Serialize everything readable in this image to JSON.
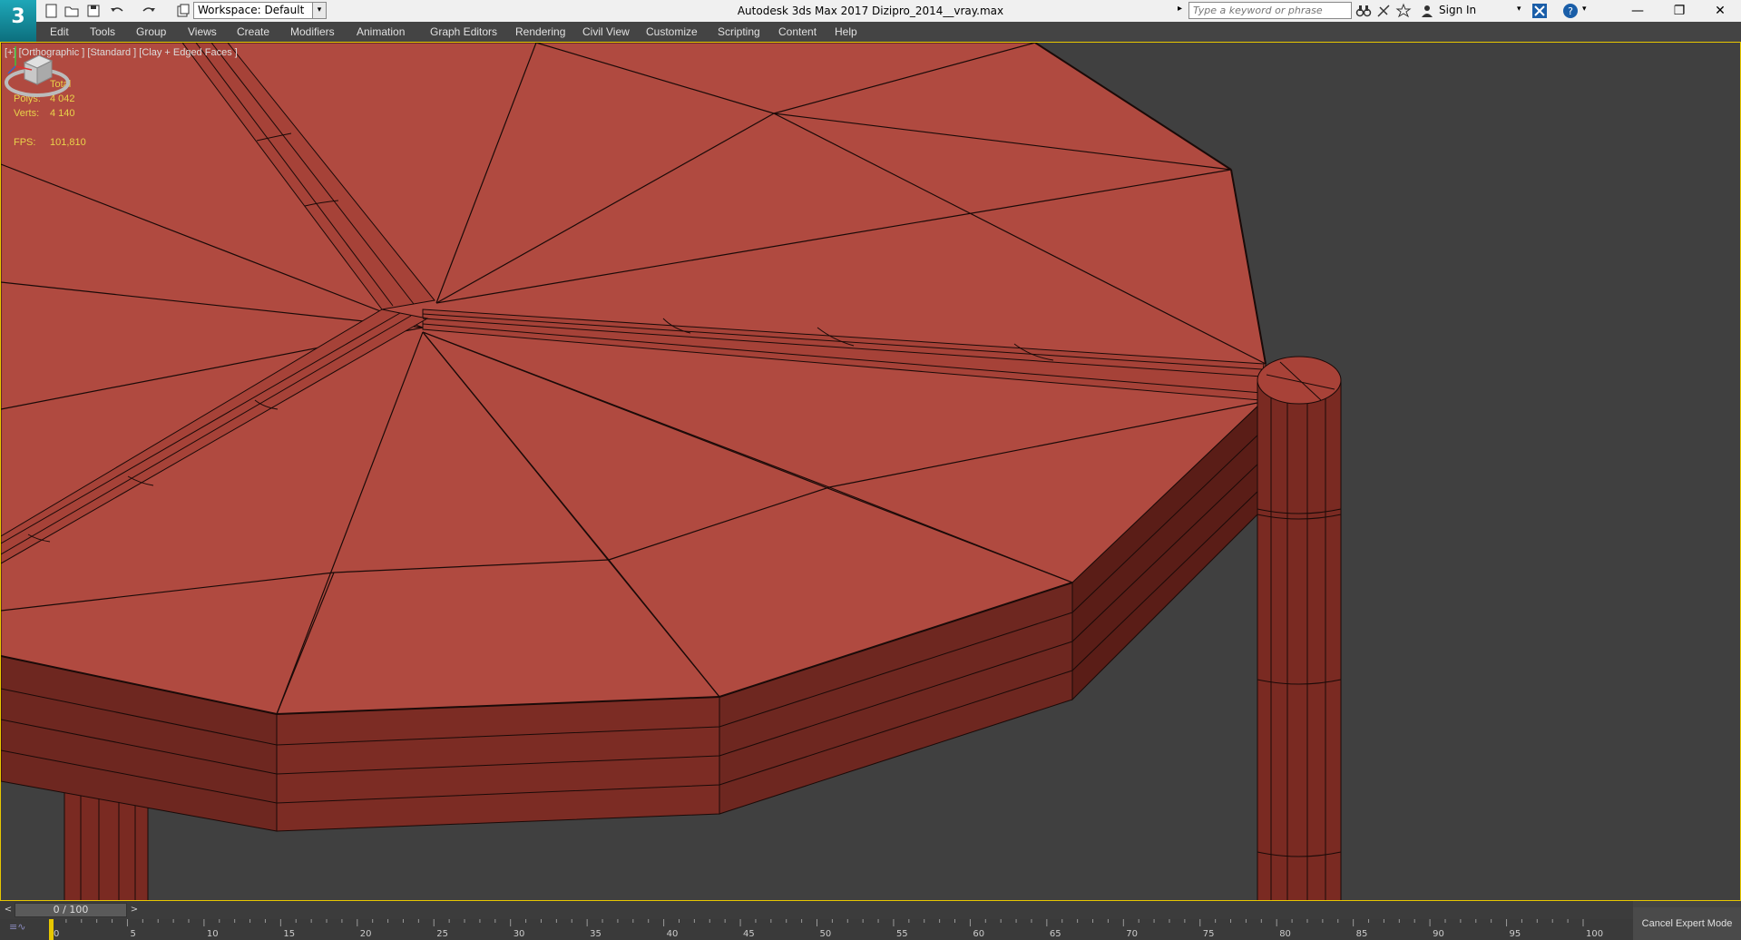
{
  "titlebar": {
    "app_logo": "3",
    "workspace": "Workspace: Default",
    "title": "Autodesk 3ds Max 2017      Dizipro_2014__vray.max",
    "search_placeholder": "Type a keyword or phrase",
    "sign_in": "Sign In",
    "window_controls": [
      "minimize-icon",
      "restore-icon",
      "close-icon"
    ]
  },
  "menubar": {
    "items": [
      "Edit",
      "Tools",
      "Group",
      "Views",
      "Create",
      "Modifiers",
      "Animation",
      "Graph Editors",
      "Rendering",
      "Civil View",
      "Customize",
      "Scripting",
      "Content",
      "Help"
    ]
  },
  "viewport": {
    "label": "[+] [Orthographic ] [Standard ] [Clay + Edged Faces ]",
    "stats": {
      "header": "Total",
      "polys_label": "Polys:",
      "polys_value": "4 042",
      "verts_label": "Verts:",
      "verts_value": "4 140",
      "fps_label": "FPS:",
      "fps_value": "101,810"
    },
    "colors": {
      "background": "#404040",
      "clay_top": "#b04a40",
      "clay_side": "#7a2a22",
      "clay_dark": "#5e1d17",
      "edge": "#1a0a08",
      "active_border": "#e7c700"
    }
  },
  "timeline": {
    "frame_display": "0 / 100",
    "ticks": [
      "0",
      "5",
      "10",
      "15",
      "20",
      "25",
      "30",
      "35",
      "40",
      "45",
      "50",
      "55",
      "60",
      "65",
      "70",
      "75",
      "80",
      "85",
      "90",
      "95",
      "100"
    ]
  },
  "expert_mode": {
    "cancel_label": "Cancel Expert Mode"
  }
}
